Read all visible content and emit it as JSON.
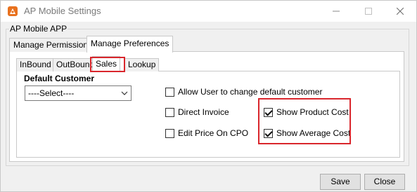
{
  "window": {
    "title": "AP Mobile Settings",
    "icon": "ap-app-icon"
  },
  "group": {
    "label": "AP Mobile APP"
  },
  "outer_tabs": [
    {
      "label": "Manage Permissions"
    },
    {
      "label": "Manage Preferences",
      "active": true
    }
  ],
  "inner_tabs": [
    {
      "label": "InBound"
    },
    {
      "label": "OutBound"
    },
    {
      "label": "Sales",
      "active": true
    },
    {
      "label": "Lookup"
    }
  ],
  "sales": {
    "default_customer_label": "Default Customer",
    "default_customer_value": "----Select----",
    "checkboxes": [
      {
        "label": "Allow User to change default customer",
        "checked": false
      },
      {
        "label": "Direct Invoice",
        "checked": false
      },
      {
        "label": "Edit Price On CPO",
        "checked": false
      },
      {
        "label": "Show Product Cost",
        "checked": true
      },
      {
        "label": "Show Average Cost",
        "checked": true
      }
    ]
  },
  "buttons": {
    "save": "Save",
    "close": "Close"
  },
  "colors": {
    "highlight": "#d9262c",
    "icon_orange": "#e8711e"
  }
}
